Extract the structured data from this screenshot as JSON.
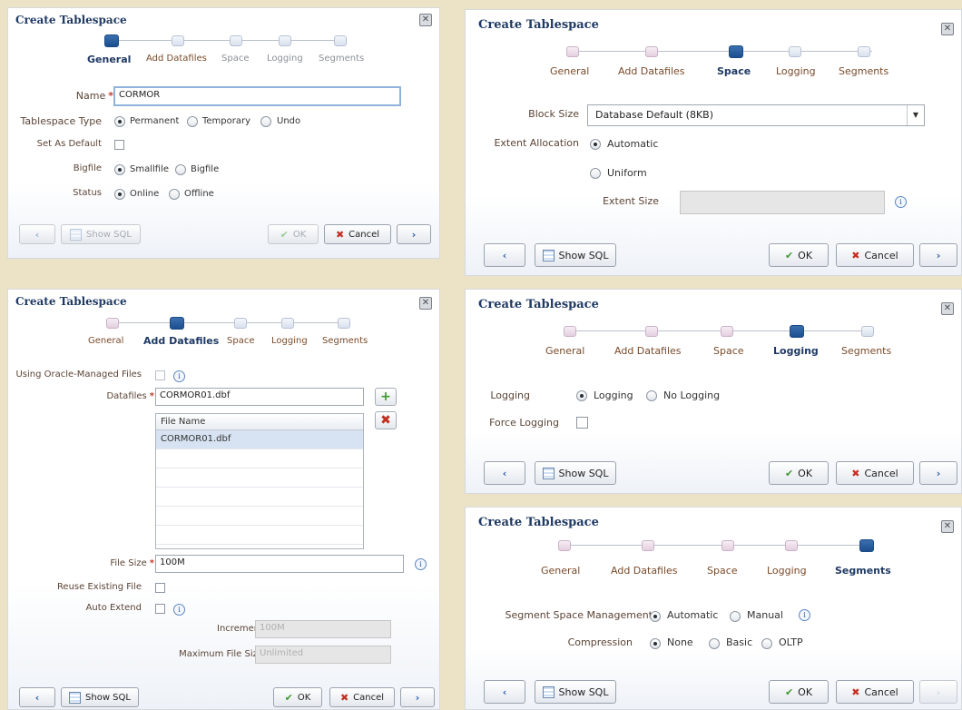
{
  "dialog_title": "Create Tablespace",
  "close_icon": "close-icon",
  "train_steps": [
    "General",
    "Add Datafiles",
    "Space",
    "Logging",
    "Segments"
  ],
  "buttons": {
    "back": "‹",
    "next": "›",
    "show_sql": "Show SQL",
    "ok": "OK",
    "cancel": "Cancel"
  },
  "icons": {
    "ok": "check-icon",
    "cancel": "x-icon",
    "show_sql": "sql-icon",
    "info": "info-icon",
    "add": "add-icon",
    "remove": "remove-icon"
  },
  "colors": {
    "background": "#ece2c6",
    "title": "#1f3a64",
    "current_step": "#1b4f8f",
    "required": "#c63a2c"
  },
  "general": {
    "name_label": "Name",
    "name_value": "CORMOR",
    "type_label": "Tablespace Type",
    "type_options": [
      "Permanent",
      "Temporary",
      "Undo"
    ],
    "type_selected": "Permanent",
    "default_label": "Set As Default",
    "bigfile_label": "Bigfile",
    "bigfile_options": [
      "Smallfile",
      "Bigfile"
    ],
    "bigfile_selected": "Smallfile",
    "status_label": "Status",
    "status_options": [
      "Online",
      "Offline"
    ],
    "status_selected": "Online"
  },
  "datafiles": {
    "omf_label": "Using Oracle-Managed Files",
    "datafiles_label": "Datafiles",
    "datafiles_value": "CORMOR01.dbf",
    "table_header": "File Name",
    "table_rows": [
      "CORMOR01.dbf",
      "",
      "",
      "",
      "",
      "",
      ""
    ],
    "size_label": "File Size",
    "size_value": "100M",
    "reuse_label": "Reuse Existing File",
    "autoextend_label": "Auto Extend",
    "increment_label": "Increment",
    "increment_value": "100M",
    "maxsize_label": "Maximum File Size",
    "maxsize_value": "Unlimited"
  },
  "space": {
    "block_label": "Block Size",
    "block_value": "Database Default (8KB)",
    "extent_label": "Extent Allocation",
    "extent_options": [
      "Automatic",
      "Uniform"
    ],
    "extent_selected": "Automatic",
    "extent_size_label": "Extent Size",
    "extent_size_value": ""
  },
  "logging": {
    "logging_label": "Logging",
    "logging_options": [
      "Logging",
      "No Logging"
    ],
    "logging_selected": "Logging",
    "force_label": "Force Logging"
  },
  "segments": {
    "ssm_label": "Segment Space Management",
    "ssm_options": [
      "Automatic",
      "Manual"
    ],
    "ssm_selected": "Automatic",
    "compression_label": "Compression",
    "compression_options": [
      "None",
      "Basic",
      "OLTP"
    ],
    "compression_selected": "None"
  }
}
